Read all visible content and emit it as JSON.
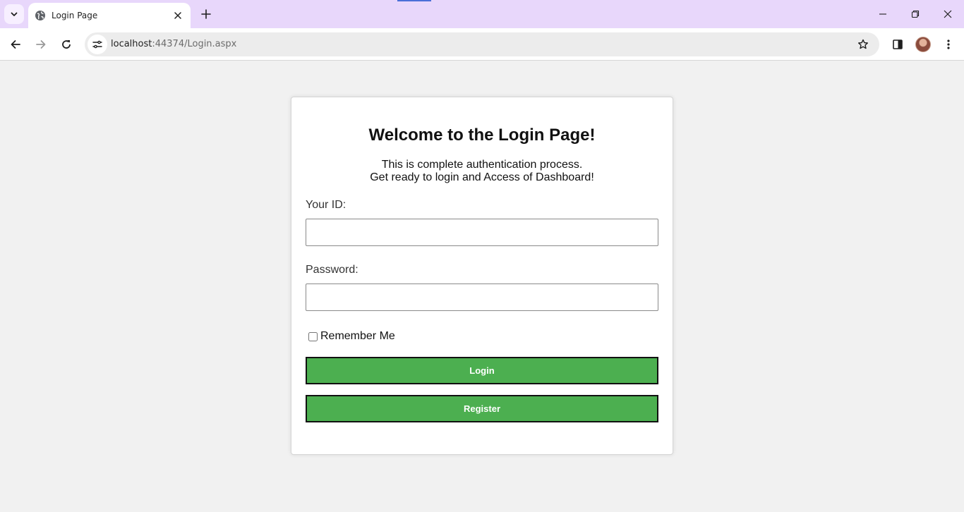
{
  "browser": {
    "tab": {
      "title": "Login Page"
    },
    "url": {
      "host": "localhost",
      "rest": ":44374/Login.aspx"
    },
    "accent_color": "#e8d7fb"
  },
  "page": {
    "title": "Welcome to the Login Page!",
    "description_line1": "This is complete authentication process.",
    "description_line2": "Get ready to login and Access of Dashboard!",
    "id_label": "Your ID:",
    "id_value": "",
    "password_label": "Password:",
    "password_value": "",
    "remember_label": "Remember Me",
    "remember_checked": false,
    "login_label": "Login",
    "register_label": "Register",
    "button_color": "#4caf50"
  }
}
